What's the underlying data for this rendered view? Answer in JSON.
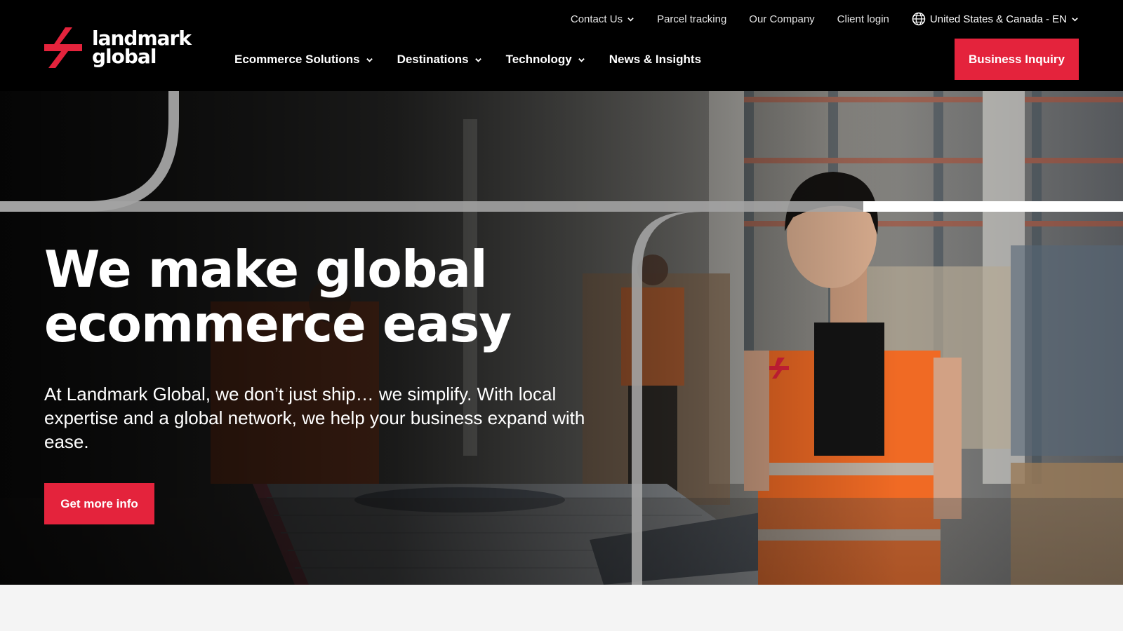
{
  "brand": {
    "name_line1": "landmark",
    "name_line2": "global",
    "accent_color": "#e4233c"
  },
  "utility_nav": {
    "contact": "Contact Us",
    "tracking": "Parcel tracking",
    "company": "Our Company",
    "login": "Client login",
    "locale": "United States & Canada - EN"
  },
  "main_nav": {
    "ecommerce": "Ecommerce Solutions",
    "destinations": "Destinations",
    "technology": "Technology",
    "news": "News & Insights"
  },
  "header": {
    "cta_label": "Business Inquiry"
  },
  "hero": {
    "title_line1": "We make global",
    "title_line2": "ecommerce easy",
    "text": "At Landmark Global, we don’t just ship… we simplify. With local expertise and a global network, we help your business expand with ease.",
    "cta_label": "Get more info"
  },
  "icons": {
    "globe": "globe-icon",
    "chevron": "chevron-down-icon",
    "logo": "landmark-logo-icon"
  }
}
